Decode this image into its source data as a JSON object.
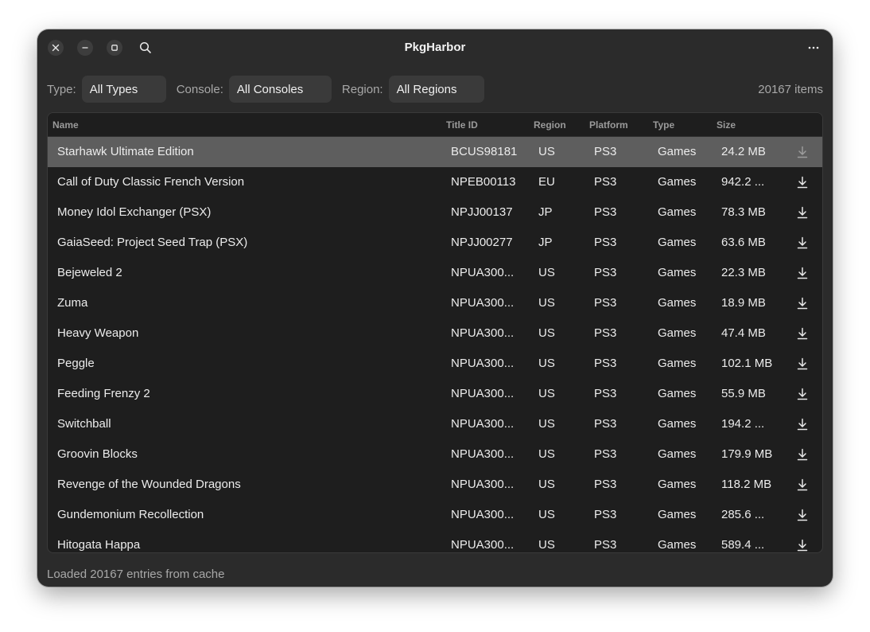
{
  "window": {
    "title": "PkgHarbor",
    "buttons": {
      "close": "close-icon",
      "minimize": "minimize-icon",
      "maximize": "maximize-icon",
      "search": "search-icon",
      "menu": "more-icon"
    }
  },
  "filters": {
    "type_label": "Type:",
    "type_value": "All Types",
    "console_label": "Console:",
    "console_value": "All Consoles",
    "region_label": "Region:",
    "region_value": "All Regions",
    "count": "20167 items"
  },
  "table": {
    "columns": {
      "name": "Name",
      "title_id": "Title ID",
      "region": "Region",
      "platform": "Platform",
      "type": "Type",
      "size": "Size"
    },
    "rows": [
      {
        "name": "Starhawk Ultimate Edition",
        "title_id": "BCUS98181",
        "region": "US",
        "platform": "PS3",
        "type": "Games",
        "size": "24.2 MB"
      },
      {
        "name": "Call of Duty Classic French Version",
        "title_id": "NPEB00113",
        "region": "EU",
        "platform": "PS3",
        "type": "Games",
        "size": "942.2 ..."
      },
      {
        "name": "Money Idol Exchanger (PSX)",
        "title_id": "NPJJ00137",
        "region": "JP",
        "platform": "PS3",
        "type": "Games",
        "size": "78.3 MB"
      },
      {
        "name": "GaiaSeed: Project Seed Trap (PSX)",
        "title_id": "NPJJ00277",
        "region": "JP",
        "platform": "PS3",
        "type": "Games",
        "size": "63.6 MB"
      },
      {
        "name": "Bejeweled 2",
        "title_id": "NPUA300...",
        "region": "US",
        "platform": "PS3",
        "type": "Games",
        "size": "22.3 MB"
      },
      {
        "name": "Zuma",
        "title_id": "NPUA300...",
        "region": "US",
        "platform": "PS3",
        "type": "Games",
        "size": "18.9 MB"
      },
      {
        "name": "Heavy Weapon",
        "title_id": "NPUA300...",
        "region": "US",
        "platform": "PS3",
        "type": "Games",
        "size": "47.4 MB"
      },
      {
        "name": "Peggle",
        "title_id": "NPUA300...",
        "region": "US",
        "platform": "PS3",
        "type": "Games",
        "size": "102.1 MB"
      },
      {
        "name": "Feeding Frenzy 2",
        "title_id": "NPUA300...",
        "region": "US",
        "platform": "PS3",
        "type": "Games",
        "size": "55.9 MB"
      },
      {
        "name": "Switchball",
        "title_id": "NPUA300...",
        "region": "US",
        "platform": "PS3",
        "type": "Games",
        "size": "194.2 ..."
      },
      {
        "name": "Groovin Blocks",
        "title_id": "NPUA300...",
        "region": "US",
        "platform": "PS3",
        "type": "Games",
        "size": "179.9 MB"
      },
      {
        "name": "Revenge of the Wounded Dragons",
        "title_id": "NPUA300...",
        "region": "US",
        "platform": "PS3",
        "type": "Games",
        "size": "118.2 MB"
      },
      {
        "name": "Gundemonium Recollection",
        "title_id": "NPUA300...",
        "region": "US",
        "platform": "PS3",
        "type": "Games",
        "size": "285.6 ..."
      },
      {
        "name": "Hitogata Happa",
        "title_id": "NPUA300...",
        "region": "US",
        "platform": "PS3",
        "type": "Games",
        "size": "589.4 ..."
      }
    ],
    "selected_index": 0,
    "row_action_icon": "download-icon"
  },
  "status": "Loaded 20167 entries from cache"
}
